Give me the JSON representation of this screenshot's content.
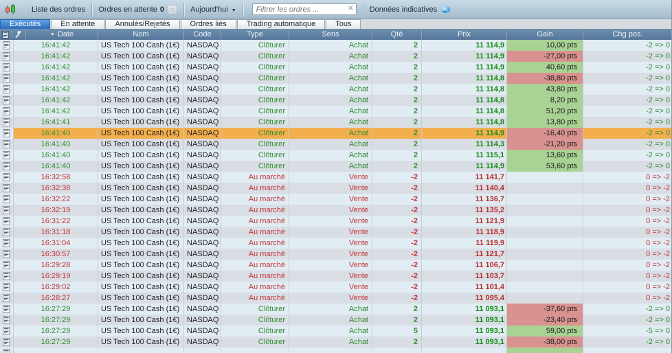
{
  "topbar": {
    "list_orders_label": "Liste des ordres",
    "pending_orders_label": "Ordres en attente",
    "pending_count": "0",
    "period_selector": "Aujourd'hui",
    "filter_placeholder": "Filtrer les ordres ...",
    "indicative_data_label": "Données indicatives"
  },
  "icons": {
    "clear_filter": "✕",
    "clear_pending_disabled": "✕",
    "dropdown_arrow": "▼",
    "sort_desc": "▼"
  },
  "tabs": [
    {
      "label": "Exécutés",
      "active": true
    },
    {
      "label": "En attente",
      "active": false
    },
    {
      "label": "Annulés/Rejetés",
      "active": false
    },
    {
      "label": "Ordres liés",
      "active": false
    },
    {
      "label": "Trading automatique",
      "active": false
    },
    {
      "label": "Tous",
      "active": false
    }
  ],
  "colors": {
    "buy_text": "#2f8d2f",
    "sell_text": "#c23537",
    "gain_positive_bg": "#a9d394",
    "gain_negative_bg": "#d9928f",
    "selected_row_bg": "#f3ae4e",
    "active_tab": "#3d7ec9",
    "header_bg": "#5f7f9e"
  },
  "table": {
    "columns": [
      "Date",
      "Nom",
      "Code",
      "Type",
      "Sens",
      "Qté",
      "Prix",
      "Gain",
      "Chg pos."
    ],
    "rows": [
      {
        "time": "16:41:42",
        "name": "US Tech 100 Cash (1€)",
        "code": "NASDAQ",
        "type": "Clôturer",
        "sens": "Achat",
        "qty": "2",
        "price": "11 114,9",
        "gain": "10,00 pts",
        "gain_bg": "green",
        "chg": "-2 => 0",
        "dir": "buy",
        "highlighted": false,
        "partial": false
      },
      {
        "time": "16:41:42",
        "name": "US Tech 100 Cash (1€)",
        "code": "NASDAQ",
        "type": "Clôturer",
        "sens": "Achat",
        "qty": "2",
        "price": "11 114,9",
        "gain": "-27,00 pts",
        "gain_bg": "red",
        "chg": "-2 => 0",
        "dir": "buy",
        "highlighted": false,
        "partial": false
      },
      {
        "time": "16:41:42",
        "name": "US Tech 100 Cash (1€)",
        "code": "NASDAQ",
        "type": "Clôturer",
        "sens": "Achat",
        "qty": "2",
        "price": "11 114,9",
        "gain": "40,60 pts",
        "gain_bg": "green",
        "chg": "-2 => 0",
        "dir": "buy",
        "highlighted": false,
        "partial": false
      },
      {
        "time": "16:41:42",
        "name": "US Tech 100 Cash (1€)",
        "code": "NASDAQ",
        "type": "Clôturer",
        "sens": "Achat",
        "qty": "2",
        "price": "11 114,8",
        "gain": "-38,80 pts",
        "gain_bg": "red",
        "chg": "-2 => 0",
        "dir": "buy",
        "highlighted": false,
        "partial": false
      },
      {
        "time": "16:41:42",
        "name": "US Tech 100 Cash (1€)",
        "code": "NASDAQ",
        "type": "Clôturer",
        "sens": "Achat",
        "qty": "2",
        "price": "11 114,8",
        "gain": "43,80 pts",
        "gain_bg": "green",
        "chg": "-2 => 0",
        "dir": "buy",
        "highlighted": false,
        "partial": false
      },
      {
        "time": "16:41:42",
        "name": "US Tech 100 Cash (1€)",
        "code": "NASDAQ",
        "type": "Clôturer",
        "sens": "Achat",
        "qty": "2",
        "price": "11 114,8",
        "gain": "8,20 pts",
        "gain_bg": "green",
        "chg": "-2 => 0",
        "dir": "buy",
        "highlighted": false,
        "partial": false
      },
      {
        "time": "16:41:42",
        "name": "US Tech 100 Cash (1€)",
        "code": "NASDAQ",
        "type": "Clôturer",
        "sens": "Achat",
        "qty": "2",
        "price": "11 114,8",
        "gain": "51,20 pts",
        "gain_bg": "green",
        "chg": "-2 => 0",
        "dir": "buy",
        "highlighted": false,
        "partial": false
      },
      {
        "time": "16:41:41",
        "name": "US Tech 100 Cash (1€)",
        "code": "NASDAQ",
        "type": "Clôturer",
        "sens": "Achat",
        "qty": "2",
        "price": "11 114,8",
        "gain": "13,80 pts",
        "gain_bg": "green",
        "chg": "-2 => 0",
        "dir": "buy",
        "highlighted": false,
        "partial": false
      },
      {
        "time": "16:41:40",
        "name": "US Tech 100 Cash (1€)",
        "code": "NASDAQ",
        "type": "Clôturer",
        "sens": "Achat",
        "qty": "2",
        "price": "11 114,9",
        "gain": "-16,40 pts",
        "gain_bg": "red",
        "chg": "-2 => 0",
        "dir": "buy",
        "highlighted": true,
        "partial": false
      },
      {
        "time": "16:41:40",
        "name": "US Tech 100 Cash (1€)",
        "code": "NASDAQ",
        "type": "Clôturer",
        "sens": "Achat",
        "qty": "2",
        "price": "11 114,3",
        "gain": "-21,20 pts",
        "gain_bg": "red",
        "chg": "-2 => 0",
        "dir": "buy",
        "highlighted": false,
        "partial": false
      },
      {
        "time": "16:41:40",
        "name": "US Tech 100 Cash (1€)",
        "code": "NASDAQ",
        "type": "Clôturer",
        "sens": "Achat",
        "qty": "2",
        "price": "11 115,1",
        "gain": "13,60 pts",
        "gain_bg": "green",
        "chg": "-2 => 0",
        "dir": "buy",
        "highlighted": false,
        "partial": false
      },
      {
        "time": "16:41:40",
        "name": "US Tech 100 Cash (1€)",
        "code": "NASDAQ",
        "type": "Clôturer",
        "sens": "Achat",
        "qty": "2",
        "price": "11 114,9",
        "gain": "53,60 pts",
        "gain_bg": "green",
        "chg": "-2 => 0",
        "dir": "buy",
        "highlighted": false,
        "partial": false
      },
      {
        "time": "16:32:58",
        "name": "US Tech 100 Cash (1€)",
        "code": "NASDAQ",
        "type": "Au marché",
        "sens": "Vente",
        "qty": "-2",
        "price": "11 141,7",
        "gain": "",
        "gain_bg": "",
        "chg": "0 => -2",
        "dir": "sell",
        "highlighted": false,
        "partial": false
      },
      {
        "time": "16:32:38",
        "name": "US Tech 100 Cash (1€)",
        "code": "NASDAQ",
        "type": "Au marché",
        "sens": "Vente",
        "qty": "-2",
        "price": "11 140,4",
        "gain": "",
        "gain_bg": "",
        "chg": "0 => -2",
        "dir": "sell",
        "highlighted": false,
        "partial": false
      },
      {
        "time": "16:32:22",
        "name": "US Tech 100 Cash (1€)",
        "code": "NASDAQ",
        "type": "Au marché",
        "sens": "Vente",
        "qty": "-2",
        "price": "11 136,7",
        "gain": "",
        "gain_bg": "",
        "chg": "0 => -2",
        "dir": "sell",
        "highlighted": false,
        "partial": false
      },
      {
        "time": "16:32:19",
        "name": "US Tech 100 Cash (1€)",
        "code": "NASDAQ",
        "type": "Au marché",
        "sens": "Vente",
        "qty": "-2",
        "price": "11 135,2",
        "gain": "",
        "gain_bg": "",
        "chg": "0 => -2",
        "dir": "sell",
        "highlighted": false,
        "partial": false
      },
      {
        "time": "16:31:22",
        "name": "US Tech 100 Cash (1€)",
        "code": "NASDAQ",
        "type": "Au marché",
        "sens": "Vente",
        "qty": "-2",
        "price": "11 121,9",
        "gain": "",
        "gain_bg": "",
        "chg": "0 => -2",
        "dir": "sell",
        "highlighted": false,
        "partial": false
      },
      {
        "time": "16:31:18",
        "name": "US Tech 100 Cash (1€)",
        "code": "NASDAQ",
        "type": "Au marché",
        "sens": "Vente",
        "qty": "-2",
        "price": "11 118,9",
        "gain": "",
        "gain_bg": "",
        "chg": "0 => -2",
        "dir": "sell",
        "highlighted": false,
        "partial": false
      },
      {
        "time": "16:31:04",
        "name": "US Tech 100 Cash (1€)",
        "code": "NASDAQ",
        "type": "Au marché",
        "sens": "Vente",
        "qty": "-2",
        "price": "11 119,9",
        "gain": "",
        "gain_bg": "",
        "chg": "0 => -2",
        "dir": "sell",
        "highlighted": false,
        "partial": false
      },
      {
        "time": "16:30:57",
        "name": "US Tech 100 Cash (1€)",
        "code": "NASDAQ",
        "type": "Au marché",
        "sens": "Vente",
        "qty": "-2",
        "price": "11 121,7",
        "gain": "",
        "gain_bg": "",
        "chg": "0 => -2",
        "dir": "sell",
        "highlighted": false,
        "partial": false
      },
      {
        "time": "16:29:28",
        "name": "US Tech 100 Cash (1€)",
        "code": "NASDAQ",
        "type": "Au marché",
        "sens": "Vente",
        "qty": "-2",
        "price": "11 106,7",
        "gain": "",
        "gain_bg": "",
        "chg": "0 => -2",
        "dir": "sell",
        "highlighted": false,
        "partial": false
      },
      {
        "time": "16:29:19",
        "name": "US Tech 100 Cash (1€)",
        "code": "NASDAQ",
        "type": "Au marché",
        "sens": "Vente",
        "qty": "-2",
        "price": "11 103,7",
        "gain": "",
        "gain_bg": "",
        "chg": "0 => -2",
        "dir": "sell",
        "highlighted": false,
        "partial": false
      },
      {
        "time": "16:29:02",
        "name": "US Tech 100 Cash (1€)",
        "code": "NASDAQ",
        "type": "Au marché",
        "sens": "Vente",
        "qty": "-2",
        "price": "11 101,4",
        "gain": "",
        "gain_bg": "",
        "chg": "0 => -2",
        "dir": "sell",
        "highlighted": false,
        "partial": false
      },
      {
        "time": "16:28:27",
        "name": "US Tech 100 Cash (1€)",
        "code": "NASDAQ",
        "type": "Au marché",
        "sens": "Vente",
        "qty": "-2",
        "price": "11 095,4",
        "gain": "",
        "gain_bg": "",
        "chg": "0 => -2",
        "dir": "sell",
        "highlighted": false,
        "partial": false
      },
      {
        "time": "16:27:29",
        "name": "US Tech 100 Cash (1€)",
        "code": "NASDAQ",
        "type": "Clôturer",
        "sens": "Achat",
        "qty": "2",
        "price": "11 093,1",
        "gain": "-37,60 pts",
        "gain_bg": "red",
        "chg": "-2 => 0",
        "dir": "buy",
        "highlighted": false,
        "partial": false
      },
      {
        "time": "16:27:29",
        "name": "US Tech 100 Cash (1€)",
        "code": "NASDAQ",
        "type": "Clôturer",
        "sens": "Achat",
        "qty": "2",
        "price": "11 093,1",
        "gain": "-23,40 pts",
        "gain_bg": "red",
        "chg": "-2 => 0",
        "dir": "buy",
        "highlighted": false,
        "partial": false
      },
      {
        "time": "16:27:29",
        "name": "US Tech 100 Cash (1€)",
        "code": "NASDAQ",
        "type": "Clôturer",
        "sens": "Achat",
        "qty": "5",
        "price": "11 093,1",
        "gain": "59,00 pts",
        "gain_bg": "green",
        "chg": "-5 => 0",
        "dir": "buy",
        "highlighted": false,
        "partial": false
      },
      {
        "time": "16:27:29",
        "name": "US Tech 100 Cash (1€)",
        "code": "NASDAQ",
        "type": "Clôturer",
        "sens": "Achat",
        "qty": "2",
        "price": "11 093,1",
        "gain": "-38,00 pts",
        "gain_bg": "red",
        "chg": "-2 => 0",
        "dir": "buy",
        "highlighted": false,
        "partial": false
      },
      {
        "time": "",
        "name": "",
        "code": "",
        "type": "",
        "sens": "",
        "qty": "",
        "price": "",
        "gain": "",
        "gain_bg": "green",
        "chg": "",
        "dir": "buy",
        "highlighted": false,
        "partial": true
      }
    ]
  }
}
